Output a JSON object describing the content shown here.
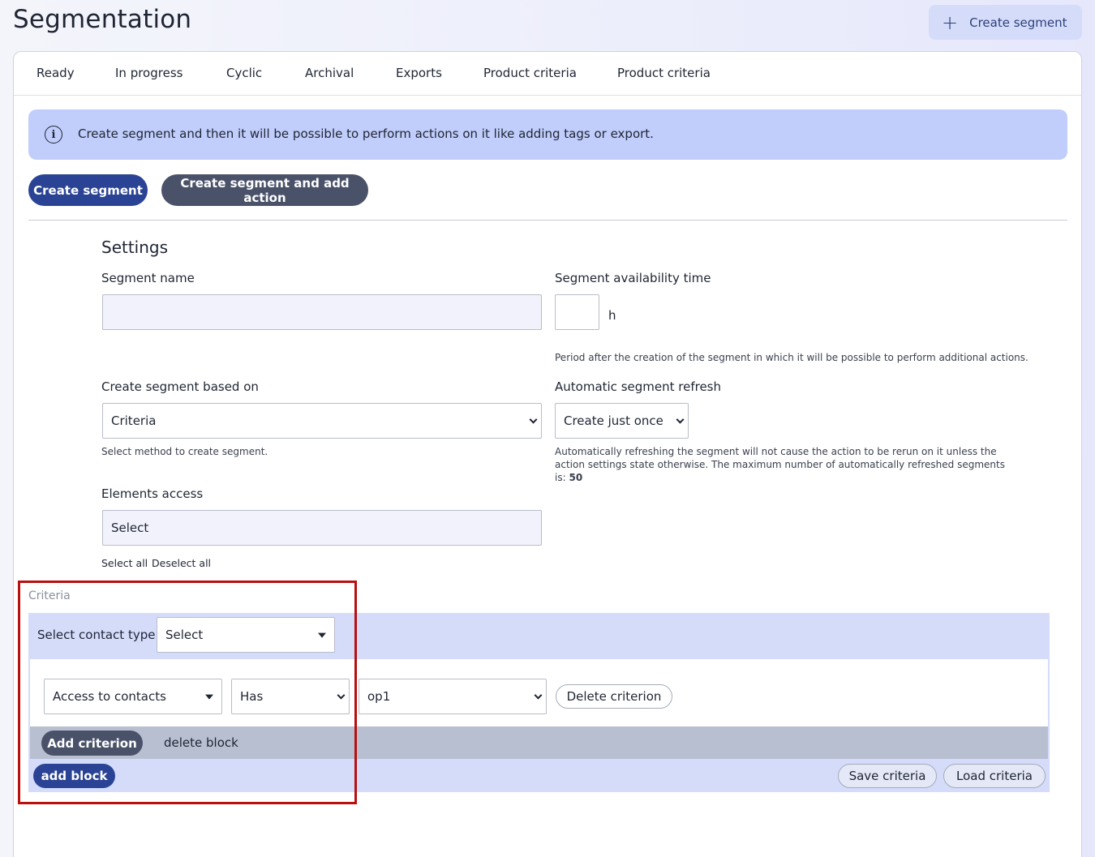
{
  "page": {
    "title": "Segmentation",
    "header_button_label": "Create segment"
  },
  "tabs": [
    {
      "label": "Ready"
    },
    {
      "label": "In progress"
    },
    {
      "label": "Cyclic"
    },
    {
      "label": "Archival"
    },
    {
      "label": "Exports"
    },
    {
      "label": "Product criteria"
    },
    {
      "label": "Product criteria"
    }
  ],
  "info": {
    "text": "Create segment and then it will be possible to perform actions on it like adding tags or export.",
    "icon": "info-icon"
  },
  "actions": {
    "create_label": "Create segment",
    "create_with_action_label": "Create segment and add action"
  },
  "settings": {
    "title": "Settings",
    "segment_name": {
      "label": "Segment name",
      "value": ""
    },
    "availability": {
      "label": "Segment availability time",
      "value": "",
      "unit": "h",
      "hint": "Period after the creation of the segment in which it will be possible to perform additional actions."
    },
    "based_on": {
      "label": "Create segment based on",
      "selected": "Criteria",
      "hint": "Select method to create segment."
    },
    "refresh": {
      "label": "Automatic segment refresh",
      "selected": "Create just once",
      "hint": "Automatically refreshing the segment will not cause the action to be rerun on it unless the action settings state otherwise. The maximum number of automatically refreshed segments is:",
      "max_value": "50"
    },
    "elements_access": {
      "label": "Elements access",
      "selected": "Select",
      "select_all": "Select all",
      "deselect_all": "Deselect all"
    }
  },
  "criteria": {
    "legend": "Criteria",
    "contact_type_label": "Select contact type",
    "contact_type_selected": "Select",
    "criterion": {
      "field": "Access to contacts",
      "operator": "Has",
      "value": "op1",
      "delete_label": "Delete criterion"
    },
    "add_criterion_label": "Add criterion",
    "delete_block_label": "delete block",
    "add_block_label": "add block",
    "save_label": "Save criteria",
    "load_label": "Load criteria"
  },
  "colors": {
    "primary": "#2a4394",
    "dark_button": "#4a526a",
    "info_bg": "#c1cdfb",
    "criteria_bg": "#d4dcfa",
    "highlight": "#b80f0f"
  }
}
